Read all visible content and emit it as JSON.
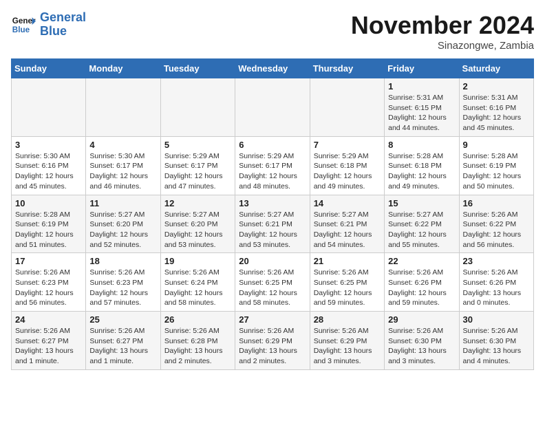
{
  "header": {
    "logo_line1": "General",
    "logo_line2": "Blue",
    "month": "November 2024",
    "location": "Sinazongwe, Zambia"
  },
  "weekdays": [
    "Sunday",
    "Monday",
    "Tuesday",
    "Wednesday",
    "Thursday",
    "Friday",
    "Saturday"
  ],
  "weeks": [
    [
      {
        "day": "",
        "info": ""
      },
      {
        "day": "",
        "info": ""
      },
      {
        "day": "",
        "info": ""
      },
      {
        "day": "",
        "info": ""
      },
      {
        "day": "",
        "info": ""
      },
      {
        "day": "1",
        "info": "Sunrise: 5:31 AM\nSunset: 6:15 PM\nDaylight: 12 hours\nand 44 minutes."
      },
      {
        "day": "2",
        "info": "Sunrise: 5:31 AM\nSunset: 6:16 PM\nDaylight: 12 hours\nand 45 minutes."
      }
    ],
    [
      {
        "day": "3",
        "info": "Sunrise: 5:30 AM\nSunset: 6:16 PM\nDaylight: 12 hours\nand 45 minutes."
      },
      {
        "day": "4",
        "info": "Sunrise: 5:30 AM\nSunset: 6:17 PM\nDaylight: 12 hours\nand 46 minutes."
      },
      {
        "day": "5",
        "info": "Sunrise: 5:29 AM\nSunset: 6:17 PM\nDaylight: 12 hours\nand 47 minutes."
      },
      {
        "day": "6",
        "info": "Sunrise: 5:29 AM\nSunset: 6:17 PM\nDaylight: 12 hours\nand 48 minutes."
      },
      {
        "day": "7",
        "info": "Sunrise: 5:29 AM\nSunset: 6:18 PM\nDaylight: 12 hours\nand 49 minutes."
      },
      {
        "day": "8",
        "info": "Sunrise: 5:28 AM\nSunset: 6:18 PM\nDaylight: 12 hours\nand 49 minutes."
      },
      {
        "day": "9",
        "info": "Sunrise: 5:28 AM\nSunset: 6:19 PM\nDaylight: 12 hours\nand 50 minutes."
      }
    ],
    [
      {
        "day": "10",
        "info": "Sunrise: 5:28 AM\nSunset: 6:19 PM\nDaylight: 12 hours\nand 51 minutes."
      },
      {
        "day": "11",
        "info": "Sunrise: 5:27 AM\nSunset: 6:20 PM\nDaylight: 12 hours\nand 52 minutes."
      },
      {
        "day": "12",
        "info": "Sunrise: 5:27 AM\nSunset: 6:20 PM\nDaylight: 12 hours\nand 53 minutes."
      },
      {
        "day": "13",
        "info": "Sunrise: 5:27 AM\nSunset: 6:21 PM\nDaylight: 12 hours\nand 53 minutes."
      },
      {
        "day": "14",
        "info": "Sunrise: 5:27 AM\nSunset: 6:21 PM\nDaylight: 12 hours\nand 54 minutes."
      },
      {
        "day": "15",
        "info": "Sunrise: 5:27 AM\nSunset: 6:22 PM\nDaylight: 12 hours\nand 55 minutes."
      },
      {
        "day": "16",
        "info": "Sunrise: 5:26 AM\nSunset: 6:22 PM\nDaylight: 12 hours\nand 56 minutes."
      }
    ],
    [
      {
        "day": "17",
        "info": "Sunrise: 5:26 AM\nSunset: 6:23 PM\nDaylight: 12 hours\nand 56 minutes."
      },
      {
        "day": "18",
        "info": "Sunrise: 5:26 AM\nSunset: 6:23 PM\nDaylight: 12 hours\nand 57 minutes."
      },
      {
        "day": "19",
        "info": "Sunrise: 5:26 AM\nSunset: 6:24 PM\nDaylight: 12 hours\nand 58 minutes."
      },
      {
        "day": "20",
        "info": "Sunrise: 5:26 AM\nSunset: 6:25 PM\nDaylight: 12 hours\nand 58 minutes."
      },
      {
        "day": "21",
        "info": "Sunrise: 5:26 AM\nSunset: 6:25 PM\nDaylight: 12 hours\nand 59 minutes."
      },
      {
        "day": "22",
        "info": "Sunrise: 5:26 AM\nSunset: 6:26 PM\nDaylight: 12 hours\nand 59 minutes."
      },
      {
        "day": "23",
        "info": "Sunrise: 5:26 AM\nSunset: 6:26 PM\nDaylight: 13 hours\nand 0 minutes."
      }
    ],
    [
      {
        "day": "24",
        "info": "Sunrise: 5:26 AM\nSunset: 6:27 PM\nDaylight: 13 hours\nand 1 minute."
      },
      {
        "day": "25",
        "info": "Sunrise: 5:26 AM\nSunset: 6:27 PM\nDaylight: 13 hours\nand 1 minute."
      },
      {
        "day": "26",
        "info": "Sunrise: 5:26 AM\nSunset: 6:28 PM\nDaylight: 13 hours\nand 2 minutes."
      },
      {
        "day": "27",
        "info": "Sunrise: 5:26 AM\nSunset: 6:29 PM\nDaylight: 13 hours\nand 2 minutes."
      },
      {
        "day": "28",
        "info": "Sunrise: 5:26 AM\nSunset: 6:29 PM\nDaylight: 13 hours\nand 3 minutes."
      },
      {
        "day": "29",
        "info": "Sunrise: 5:26 AM\nSunset: 6:30 PM\nDaylight: 13 hours\nand 3 minutes."
      },
      {
        "day": "30",
        "info": "Sunrise: 5:26 AM\nSunset: 6:30 PM\nDaylight: 13 hours\nand 4 minutes."
      }
    ]
  ]
}
